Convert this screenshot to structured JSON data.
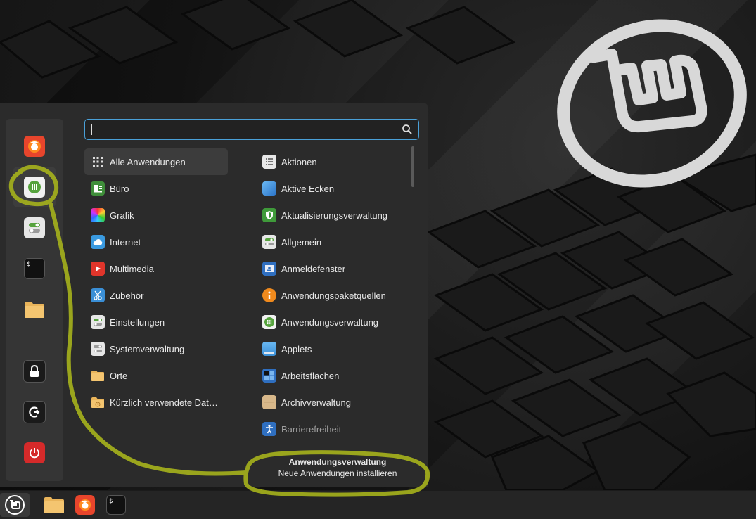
{
  "search": {
    "value": "",
    "placeholder": ""
  },
  "sidebar": {
    "items": [
      {
        "name": "firefox",
        "icon": "firefox-icon"
      },
      {
        "name": "software-manager",
        "icon": "software-manager-icon"
      },
      {
        "name": "settings",
        "icon": "toggle-icon"
      },
      {
        "name": "terminal",
        "icon": "terminal-icon",
        "glyph": "$_"
      },
      {
        "name": "files",
        "icon": "folder-icon"
      },
      {
        "name": "lock",
        "icon": "lock-icon"
      },
      {
        "name": "logout",
        "icon": "logout-icon"
      },
      {
        "name": "shutdown",
        "icon": "power-icon"
      }
    ]
  },
  "categories": [
    {
      "label": "Alle Anwendungen",
      "icon": "grid-icon"
    },
    {
      "label": "Büro",
      "icon": "office-icon"
    },
    {
      "label": "Grafik",
      "icon": "graphics-icon"
    },
    {
      "label": "Internet",
      "icon": "cloud-icon"
    },
    {
      "label": "Multimedia",
      "icon": "play-icon"
    },
    {
      "label": "Zubehör",
      "icon": "scissors-icon"
    },
    {
      "label": "Einstellungen",
      "icon": "toggle-icon"
    },
    {
      "label": "Systemverwaltung",
      "icon": "toggle-icon"
    },
    {
      "label": "Orte",
      "icon": "folder-icon"
    },
    {
      "label": "Kürzlich verwendete Dat…",
      "icon": "recent-folder-icon"
    }
  ],
  "apps": [
    {
      "label": "Aktionen",
      "icon": "list-icon"
    },
    {
      "label": "Aktive Ecken",
      "icon": "corner-icon"
    },
    {
      "label": "Aktualisierungsverwaltung",
      "icon": "shield-icon"
    },
    {
      "label": "Allgemein",
      "icon": "toggle-icon"
    },
    {
      "label": "Anmeldefenster",
      "icon": "login-window-icon"
    },
    {
      "label": "Anwendungspaketquellen",
      "icon": "info-icon"
    },
    {
      "label": "Anwendungsverwaltung",
      "icon": "software-manager-icon"
    },
    {
      "label": "Applets",
      "icon": "applets-icon"
    },
    {
      "label": "Arbeitsflächen",
      "icon": "workspaces-icon"
    },
    {
      "label": "Archivverwaltung",
      "icon": "archive-icon"
    },
    {
      "label": "Barrierefreiheit",
      "icon": "accessibility-icon"
    }
  ],
  "tooltip": {
    "title": "Anwendungsverwaltung",
    "description": "Neue Anwendungen installieren"
  },
  "taskbar": {
    "items": [
      {
        "name": "menu",
        "icon": "mint-logo-icon"
      },
      {
        "name": "files",
        "icon": "folder-icon"
      },
      {
        "name": "firefox",
        "icon": "firefox-icon"
      },
      {
        "name": "terminal",
        "icon": "terminal-icon",
        "glyph": "$_"
      }
    ]
  },
  "colors": {
    "accent": "#4aa0d8",
    "annotation": "#a6b21c",
    "firefox": "#e8452c",
    "green": "#56a33d",
    "folder": "#e9b45a",
    "power": "#d52a2a"
  }
}
